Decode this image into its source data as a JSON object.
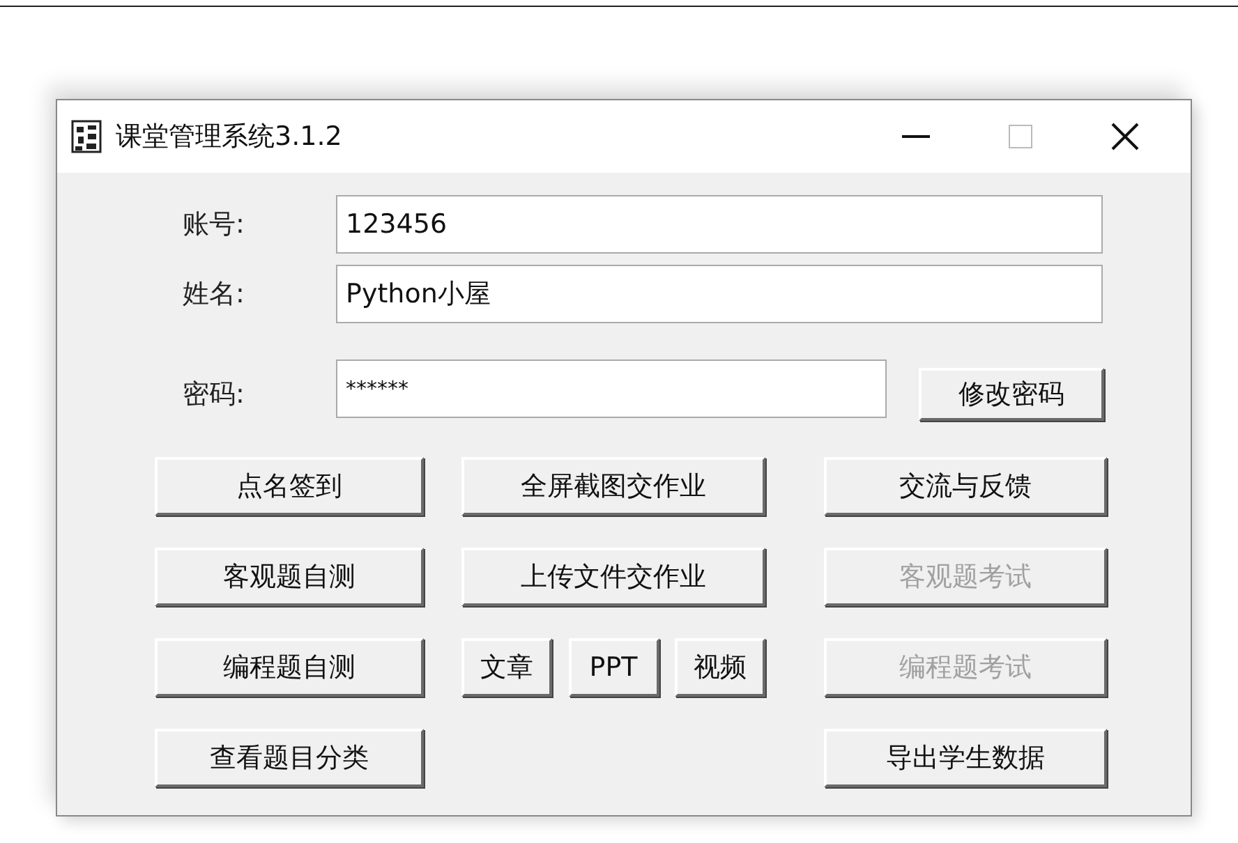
{
  "window": {
    "title": "课堂管理系统3.1.2"
  },
  "fields": [
    {
      "label": "账号:",
      "value": "123456"
    },
    {
      "label": "姓名:",
      "value": "Python小屋"
    }
  ],
  "password": {
    "label": "密码:",
    "value": "******",
    "button": "修改密码"
  },
  "button_rows": [
    {
      "left": {
        "label": "点名签到",
        "disabled": false
      },
      "middle": [
        {
          "label": "全屏截图交作业",
          "disabled": false
        }
      ],
      "right": {
        "label": "交流与反馈",
        "disabled": false
      }
    },
    {
      "left": {
        "label": "客观题自测",
        "disabled": false
      },
      "middle": [
        {
          "label": "上传文件交作业",
          "disabled": false
        }
      ],
      "right": {
        "label": "客观题考试",
        "disabled": true
      }
    },
    {
      "left": {
        "label": "编程题自测",
        "disabled": false
      },
      "middle": [
        {
          "label": "文章",
          "disabled": false
        },
        {
          "label": "PPT",
          "disabled": false
        },
        {
          "label": "视频",
          "disabled": false
        }
      ],
      "right": {
        "label": "编程题考试",
        "disabled": true
      }
    },
    {
      "left": {
        "label": "查看题目分类",
        "disabled": false
      },
      "right": {
        "label": "导出学生数据",
        "disabled": false
      }
    }
  ]
}
